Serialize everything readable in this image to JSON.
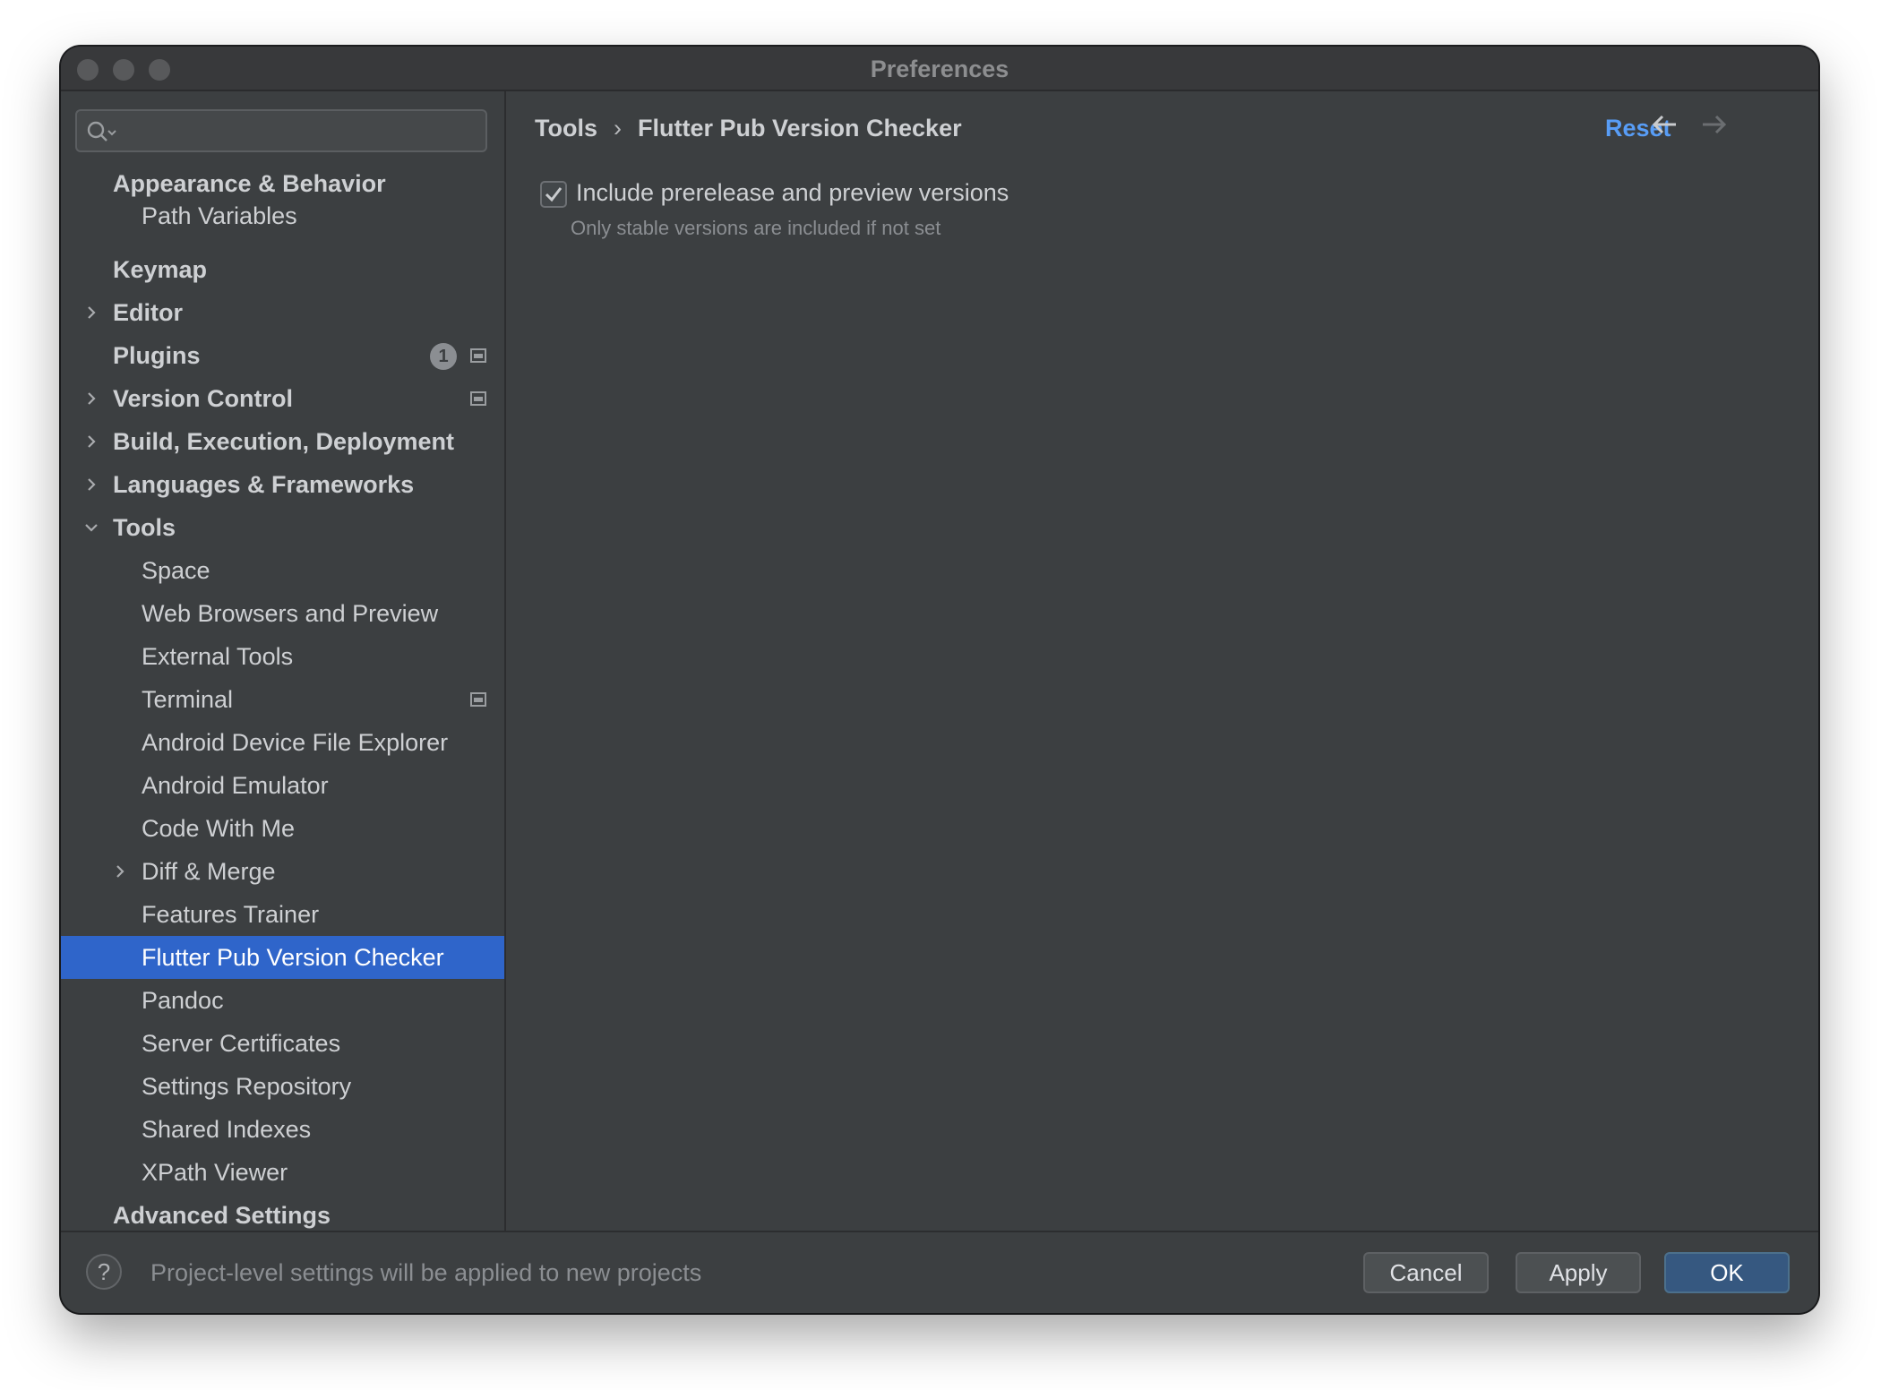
{
  "window": {
    "title": "Preferences"
  },
  "search": {
    "placeholder": ""
  },
  "sidebar": {
    "items": [
      {
        "label": "Appearance & Behavior",
        "bold": true,
        "level": 0,
        "chevron": ""
      },
      {
        "label": "Path Variables",
        "bold": false,
        "level": 1,
        "chevron": ""
      },
      {
        "label": "Keymap",
        "bold": true,
        "level": 0,
        "chevron": ""
      },
      {
        "label": "Editor",
        "bold": true,
        "level": 0,
        "chevron": "right"
      },
      {
        "label": "Plugins",
        "bold": true,
        "level": 0,
        "chevron": "",
        "badge": "1",
        "project_icon": true
      },
      {
        "label": "Version Control",
        "bold": true,
        "level": 0,
        "chevron": "right",
        "project_icon": true
      },
      {
        "label": "Build, Execution, Deployment",
        "bold": true,
        "level": 0,
        "chevron": "right"
      },
      {
        "label": "Languages & Frameworks",
        "bold": true,
        "level": 0,
        "chevron": "right"
      },
      {
        "label": "Tools",
        "bold": true,
        "level": 0,
        "chevron": "down"
      },
      {
        "label": "Space",
        "bold": false,
        "level": 1,
        "chevron": ""
      },
      {
        "label": "Web Browsers and Preview",
        "bold": false,
        "level": 1,
        "chevron": ""
      },
      {
        "label": "External Tools",
        "bold": false,
        "level": 1,
        "chevron": ""
      },
      {
        "label": "Terminal",
        "bold": false,
        "level": 1,
        "chevron": "",
        "project_icon": true
      },
      {
        "label": "Android Device File Explorer",
        "bold": false,
        "level": 1,
        "chevron": ""
      },
      {
        "label": "Android Emulator",
        "bold": false,
        "level": 1,
        "chevron": ""
      },
      {
        "label": "Code With Me",
        "bold": false,
        "level": 1,
        "chevron": ""
      },
      {
        "label": "Diff & Merge",
        "bold": false,
        "level": 1,
        "chevron": "right"
      },
      {
        "label": "Features Trainer",
        "bold": false,
        "level": 1,
        "chevron": ""
      },
      {
        "label": "Flutter Pub Version Checker",
        "bold": false,
        "level": 1,
        "chevron": "",
        "selected": true
      },
      {
        "label": "Pandoc",
        "bold": false,
        "level": 1,
        "chevron": ""
      },
      {
        "label": "Server Certificates",
        "bold": false,
        "level": 1,
        "chevron": ""
      },
      {
        "label": "Settings Repository",
        "bold": false,
        "level": 1,
        "chevron": ""
      },
      {
        "label": "Shared Indexes",
        "bold": false,
        "level": 1,
        "chevron": ""
      },
      {
        "label": "XPath Viewer",
        "bold": false,
        "level": 1,
        "chevron": ""
      },
      {
        "label": "Advanced Settings",
        "bold": true,
        "level": 0,
        "chevron": ""
      }
    ]
  },
  "header": {
    "breadcrumb": [
      "Tools",
      "Flutter Pub Version Checker"
    ],
    "separator": "›",
    "reset_label": "Reset",
    "back_icon": "arrow-left-icon",
    "forward_icon": "arrow-right-icon"
  },
  "settings": {
    "include_prerelease": {
      "label": "Include prerelease and preview versions",
      "hint": "Only stable versions are included if not set",
      "checked": true
    }
  },
  "footer": {
    "help_label": "?",
    "message": "Project-level settings will be applied to new projects",
    "cancel_label": "Cancel",
    "apply_label": "Apply",
    "ok_label": "OK"
  },
  "colors": {
    "accent": "#589df6",
    "selection": "#2f65ca",
    "background": "#3c3f41",
    "ok_button": "#365880"
  }
}
